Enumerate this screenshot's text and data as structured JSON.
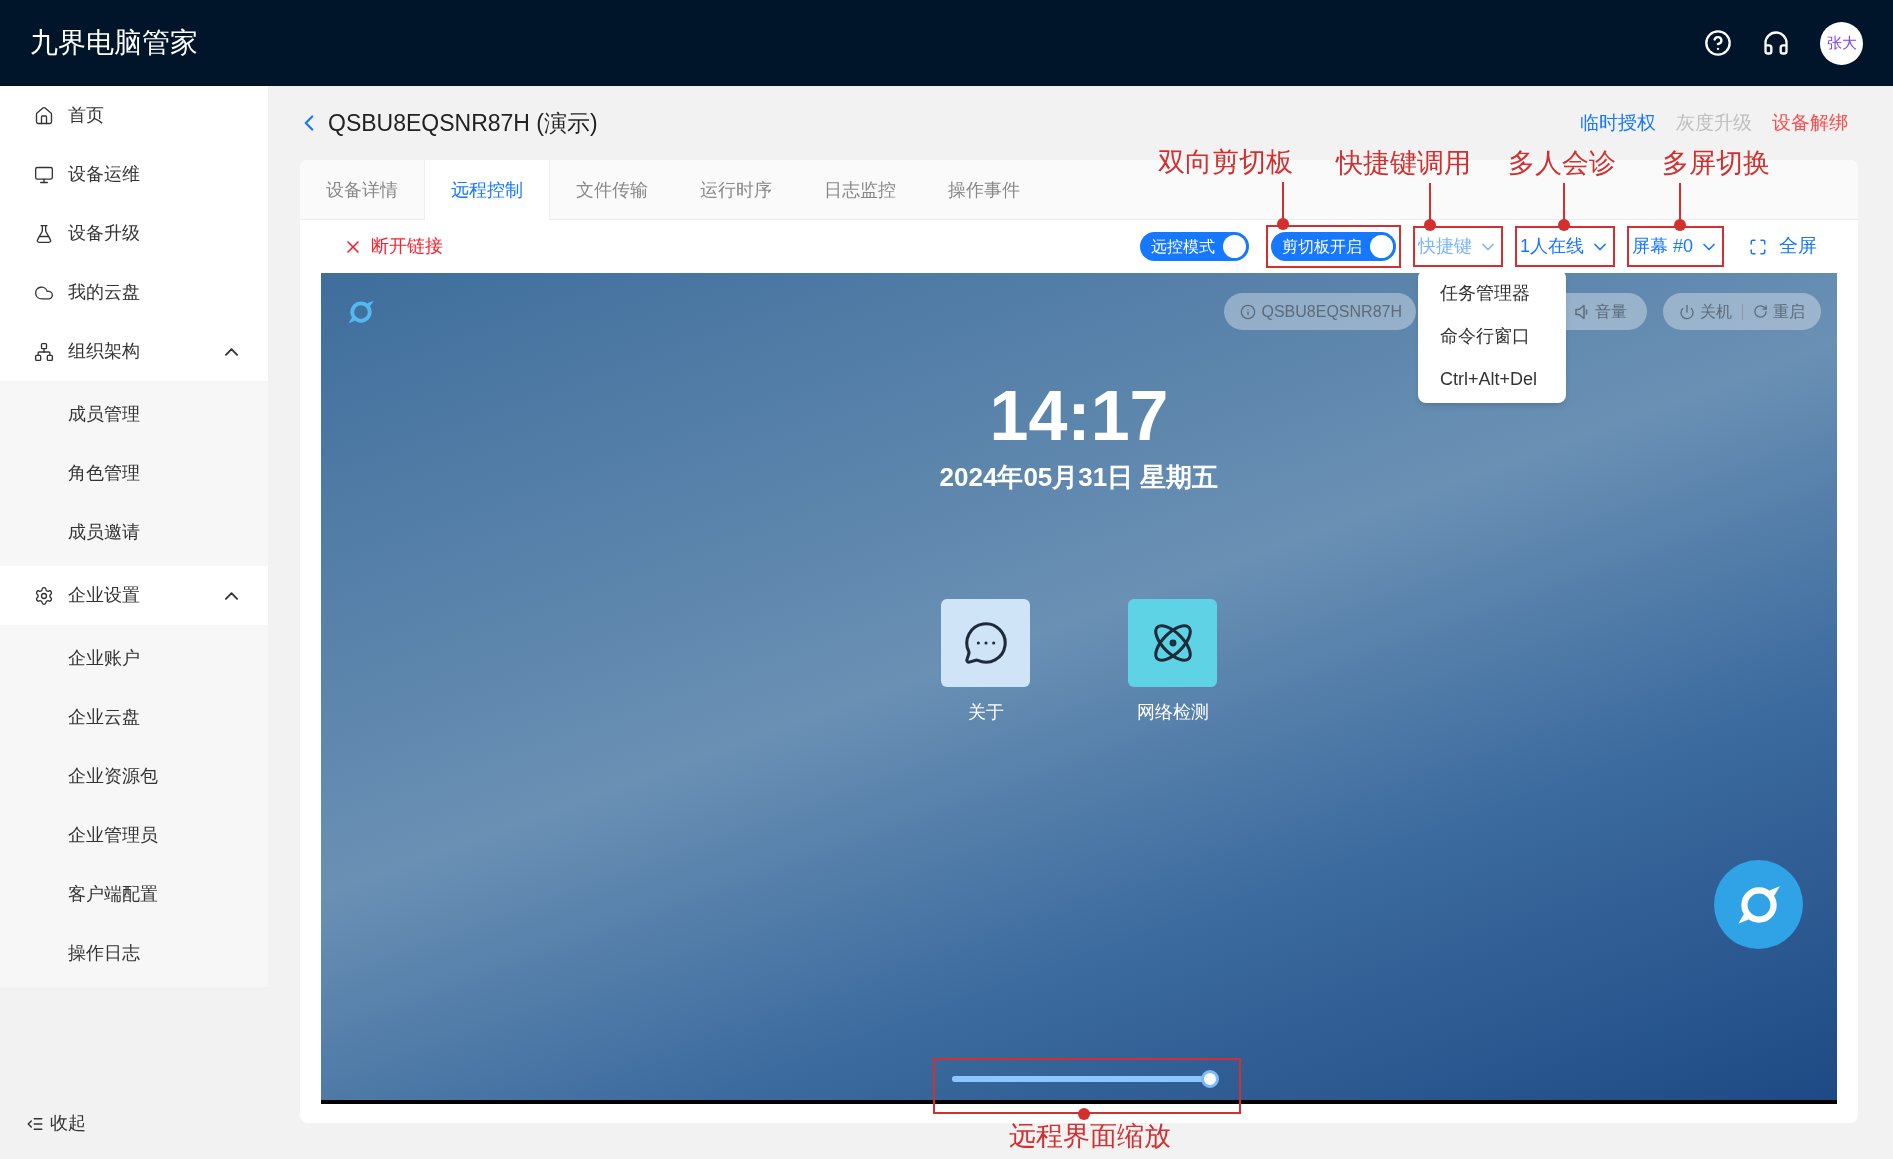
{
  "app": {
    "title": "九界电脑管家",
    "avatar": "张大"
  },
  "sidebar": {
    "items": [
      {
        "label": "首页"
      },
      {
        "label": "设备运维"
      },
      {
        "label": "设备升级"
      },
      {
        "label": "我的云盘"
      },
      {
        "label": "组织架构",
        "expanded": true,
        "children": [
          {
            "label": "成员管理"
          },
          {
            "label": "角色管理"
          },
          {
            "label": "成员邀请"
          }
        ]
      },
      {
        "label": "企业设置",
        "expanded": true,
        "children": [
          {
            "label": "企业账户"
          },
          {
            "label": "企业云盘"
          },
          {
            "label": "企业资源包"
          },
          {
            "label": "企业管理员"
          },
          {
            "label": "客户端配置"
          },
          {
            "label": "操作日志"
          }
        ]
      }
    ],
    "collapse": "收起"
  },
  "page": {
    "title": "QSBU8EQSNR87H (演示)",
    "actions": [
      {
        "label": "临时授权",
        "kind": "primary"
      },
      {
        "label": "灰度升级",
        "kind": "disabled"
      },
      {
        "label": "设备解绑",
        "kind": "danger"
      }
    ]
  },
  "tabs": [
    {
      "label": "设备详情",
      "selected": false
    },
    {
      "label": "远程控制",
      "selected": true
    },
    {
      "label": "文件传输",
      "selected": false
    },
    {
      "label": "运行时序",
      "selected": false
    },
    {
      "label": "日志监控",
      "selected": false
    },
    {
      "label": "操作事件",
      "selected": false
    }
  ],
  "toolbar": {
    "disconnect": "断开链接",
    "remote_mode": {
      "label": "远控模式",
      "on": true
    },
    "clipboard": {
      "label": "剪切板开启",
      "on": true,
      "annotation": "双向剪切板"
    },
    "shortcuts": {
      "label": "快捷键",
      "expanded": true,
      "annotation": "快捷键调用",
      "menu": [
        "任务管理器",
        "命令行窗口",
        "Ctrl+Alt+Del"
      ]
    },
    "online": {
      "label": "1人在线",
      "annotation": "多人会诊"
    },
    "screen": {
      "label": "屏幕 #0",
      "annotation": "多屏切换"
    },
    "fullscreen": "全屏"
  },
  "remote": {
    "device_id": "QSBU8EQSNR87H",
    "volume": "音量",
    "shutdown": "关机",
    "restart": "重启",
    "time": "14:17",
    "date": "2024年05月31日 星期五",
    "apps": [
      {
        "label": "关于",
        "kind": "chat"
      },
      {
        "label": "网络检测",
        "kind": "network"
      }
    ],
    "zoom": {
      "level": 1,
      "annotation": "远程界面缩放"
    }
  }
}
